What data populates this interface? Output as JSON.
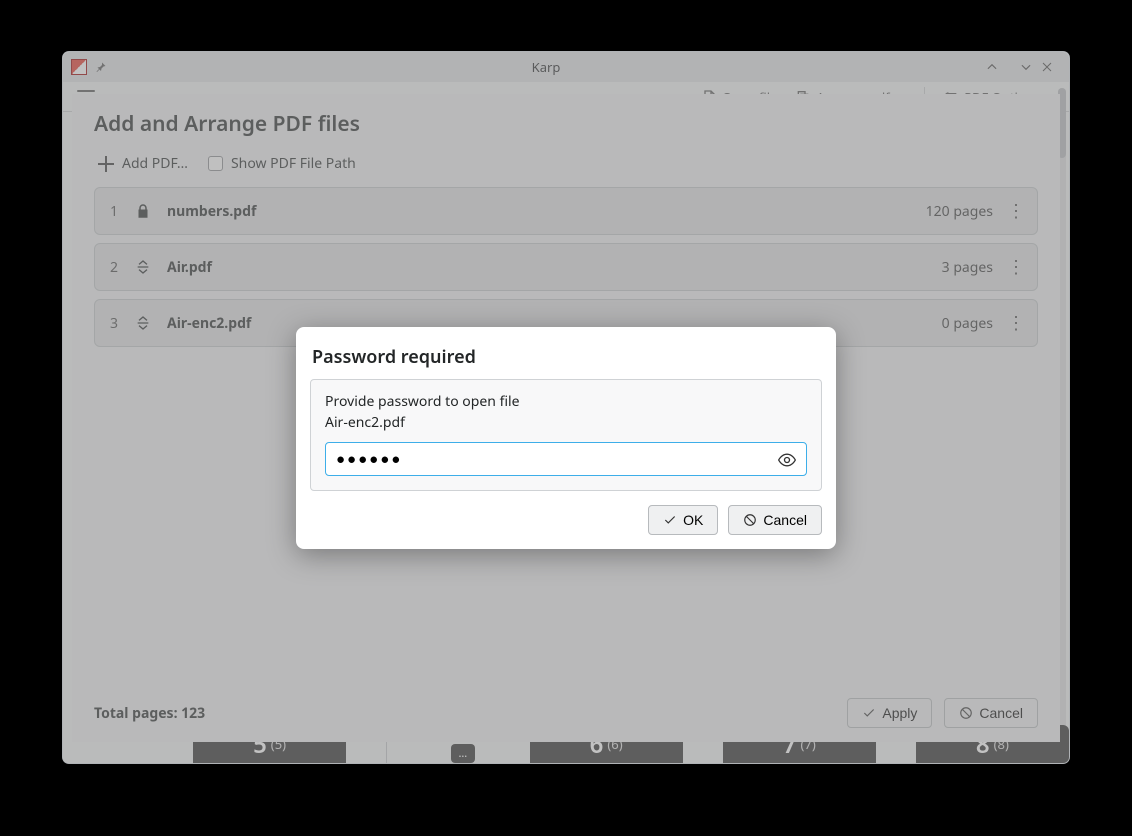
{
  "window": {
    "title": "Karp"
  },
  "toolbar": {
    "openfile": "Open file",
    "arrange": "Arrange pdfs…",
    "pdfoptions": "PDF Options"
  },
  "sheet": {
    "title": "Add and Arrange PDF files",
    "add_pdf": "Add PDF…",
    "show_path": "Show PDF File Path",
    "files": [
      {
        "idx": "1",
        "icon": "lock",
        "name": "numbers.pdf",
        "pages": "120 pages"
      },
      {
        "idx": "2",
        "icon": "reorder",
        "name": "Air.pdf",
        "pages": "3 pages"
      },
      {
        "idx": "3",
        "icon": "reorder",
        "name": "Air-enc2.pdf",
        "pages": "0 pages"
      }
    ],
    "total_label": "Total pages: 123",
    "apply": "Apply",
    "cancel": "Cancel"
  },
  "pwdlg": {
    "title": "Password required",
    "msg1": "Provide password to open file",
    "msg2": "Air-enc2.pdf",
    "value": "●●●●●●",
    "ok": "OK",
    "cancel": "Cancel"
  },
  "thumbs": {
    "a": "5",
    "a_sub": "(5)",
    "b": "6",
    "b_sub": "(6)",
    "c": "7",
    "c_sub": "(7)",
    "d": "8",
    "d_sub": "(8)"
  }
}
